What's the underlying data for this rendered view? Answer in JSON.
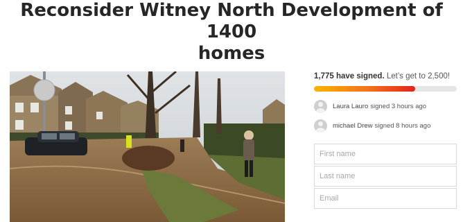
{
  "petition": {
    "title_line1": "Reconsider Witney North Development of 1400",
    "title_line2": "homes"
  },
  "progress": {
    "signed_text": "1,775 have signed.",
    "goal_text": "Let’s get to 2,500!",
    "fraction": 0.71
  },
  "recent_signers": [
    {
      "name": "Laura Lauro",
      "action": "signed 3 hours ago"
    },
    {
      "name": "michael Drew",
      "action": "signed 8 hours ago"
    }
  ],
  "form": {
    "first_name_placeholder": "First name",
    "last_name_placeholder": "Last name",
    "email_placeholder": "Email"
  },
  "colors": {
    "progress_start": "#f7b500",
    "progress_end": "#e2231a",
    "flood_water": "#8a6a43"
  }
}
